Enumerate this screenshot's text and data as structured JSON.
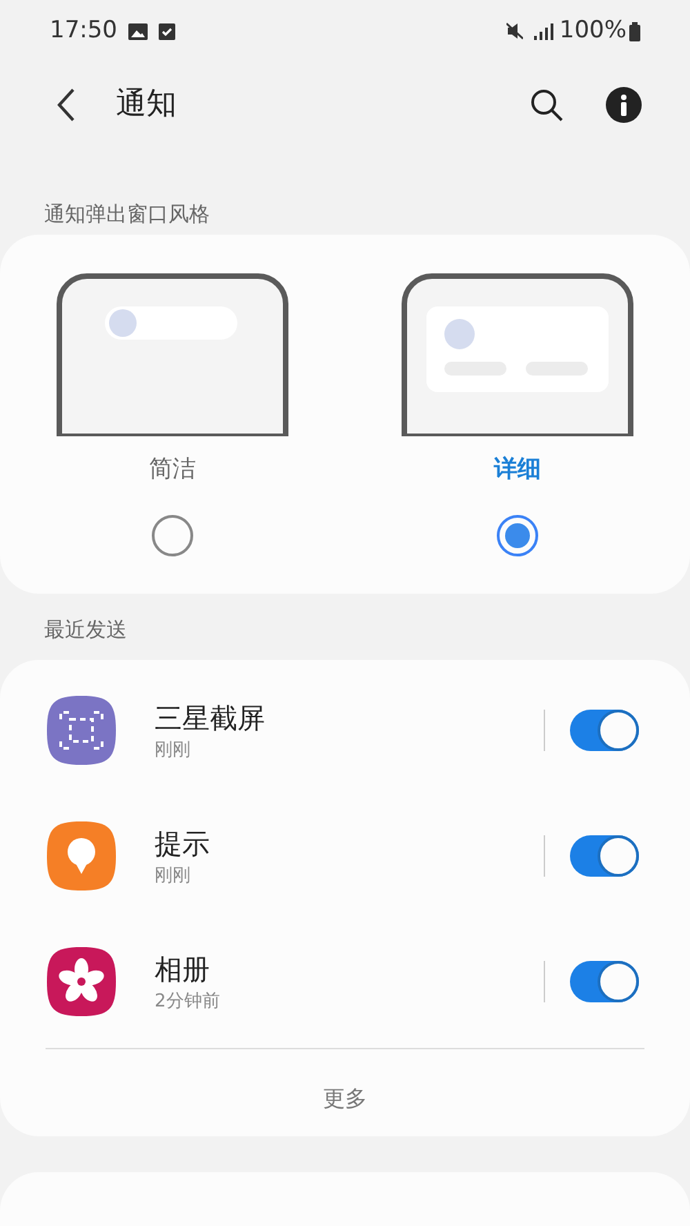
{
  "status_bar": {
    "time": "17:50",
    "battery": "100%"
  },
  "header": {
    "title": "通知"
  },
  "popup_style": {
    "heading": "通知弹出窗口风格",
    "options": [
      {
        "label": "简洁",
        "kind": "brief",
        "selected": false
      },
      {
        "label": "详细",
        "kind": "detailed",
        "selected": true
      }
    ]
  },
  "recent": {
    "heading": "最近发送",
    "apps": [
      {
        "name": "三星截屏",
        "time": "刚刚",
        "kind": "screenshot",
        "on": true
      },
      {
        "name": "提示",
        "time": "刚刚",
        "kind": "tips",
        "on": true
      },
      {
        "name": "相册",
        "time": "2分钟前",
        "kind": "gallery",
        "on": true
      }
    ],
    "more": "更多"
  }
}
